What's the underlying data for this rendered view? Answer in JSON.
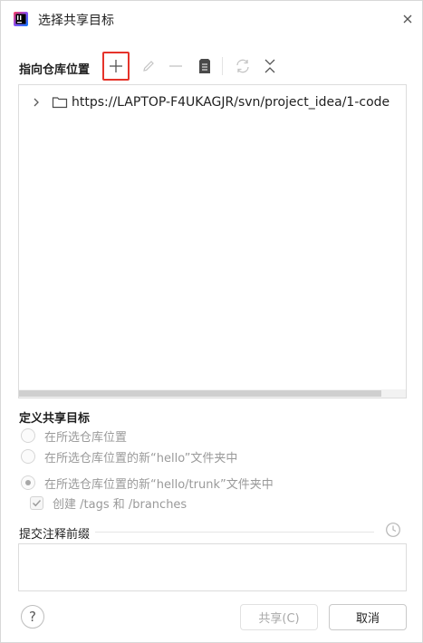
{
  "window": {
    "title": "选择共享目标",
    "logo": "intellij-idea-logo",
    "close_icon": "close-icon"
  },
  "repository": {
    "label": "指向仓库位置",
    "toolbar": {
      "add_icon": "plus-icon",
      "edit_icon": "pencil-icon",
      "remove_icon": "minus-icon",
      "doc_icon": "document-icon",
      "refresh_icon": "refresh-icon",
      "collapse_icon": "collapse-all-icon"
    },
    "tree": {
      "items": [
        {
          "label": "https://LAPTOP-F4UKAGJR/svn/project_idea/1-code",
          "expanded": false
        }
      ]
    }
  },
  "share_target": {
    "label": "定义共享目标",
    "options": [
      {
        "label": "在所选仓库位置",
        "checked": false
      },
      {
        "label": "在所选仓库位置的新“hello”文件夹中",
        "checked": false
      },
      {
        "label": "在所选仓库位置的新“hello/trunk”文件夹中",
        "checked": true
      }
    ],
    "create_option": {
      "label": "创建 /tags 和 /branches",
      "checked": true
    }
  },
  "commit_comment": {
    "label": "提交注释前缀",
    "value": "",
    "history_icon": "clock-icon"
  },
  "footer": {
    "help_label": "?",
    "share_label": "共享(C)",
    "cancel_label": "取消"
  },
  "colors": {
    "highlight_border": "#e5332a",
    "disabled_text": "#9a9a9a"
  }
}
